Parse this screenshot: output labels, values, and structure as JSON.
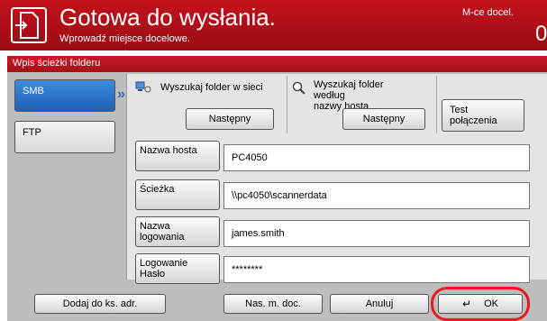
{
  "header": {
    "title": "Gotowa do wysłania.",
    "subtitle": "Wprowadź miejsce docelowe.",
    "dest_label": "M-ce docel.",
    "dest_count": "0",
    "brand_color": "#b5121b"
  },
  "panel": {
    "title": "Wpis ścieżki folderu"
  },
  "protocols": [
    {
      "label": "SMB",
      "active": true
    },
    {
      "label": "FTP",
      "active": false
    }
  ],
  "options": {
    "network_search": {
      "icon": "network-computer-icon",
      "text": "Wyszukaj folder w sieci",
      "button": "Następny"
    },
    "host_search": {
      "icon": "magnifier-icon",
      "text_line1": "Wyszukaj folder",
      "text_line2": "według",
      "text_line3": "nazwy hosta",
      "button": "Następny"
    },
    "test": {
      "line1": "Test",
      "line2": "połączenia"
    }
  },
  "fields": [
    {
      "label_line1": "Nazwa hosta",
      "label_line2": "",
      "value": "PC4050"
    },
    {
      "label_line1": "Ścieżka",
      "label_line2": "",
      "value": "\\\\pc4050\\scannerdata"
    },
    {
      "label_line1": "Nazwa",
      "label_line2": "logowania",
      "value": "james.smith"
    },
    {
      "label_line1": "Logowanie",
      "label_line2": "Hasło",
      "value": "********"
    }
  ],
  "footer": {
    "add_to_book": "Dodaj do ks. adr.",
    "doc_name": "Nas. m. doc.",
    "cancel": "Anuluj",
    "ok": "OK",
    "ok_icon": "enter-icon",
    "highlight_color": "#e31b23"
  }
}
